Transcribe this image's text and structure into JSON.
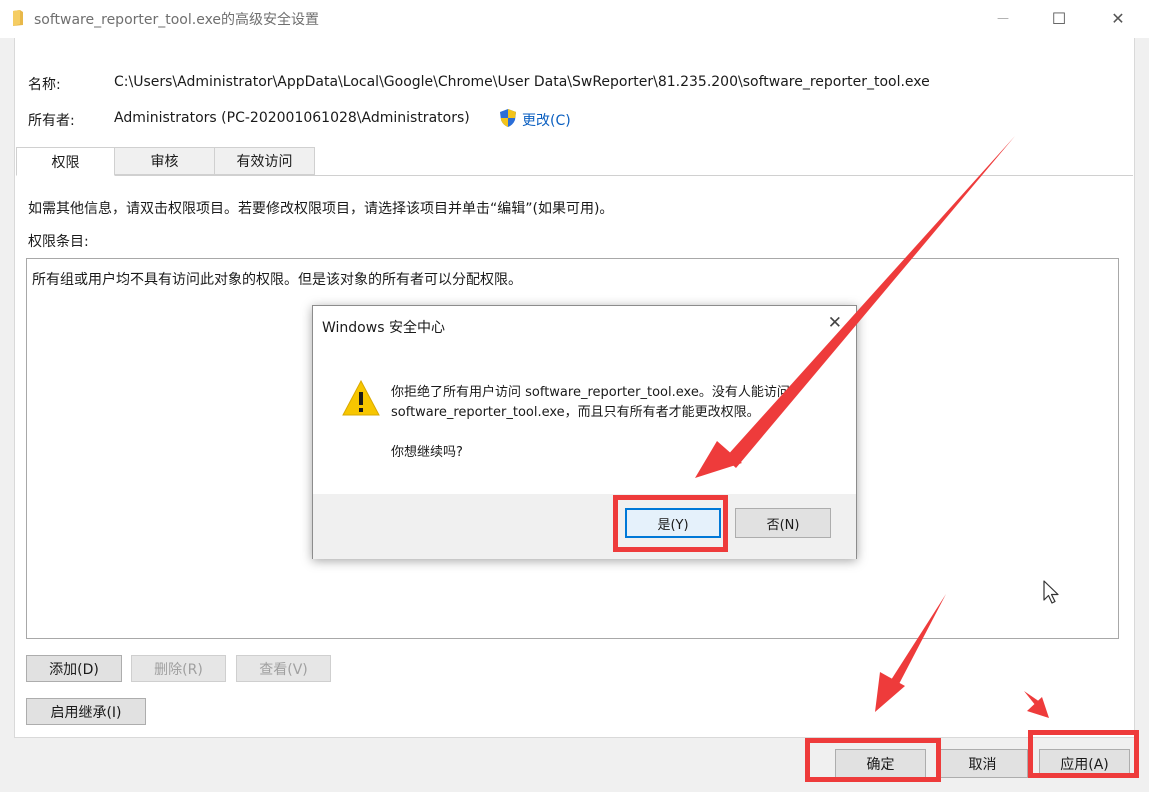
{
  "window": {
    "title": "software_reporter_tool.exe的高级安全设置",
    "controls": {
      "minimize": "—",
      "maximize": "☐",
      "close": "✕"
    }
  },
  "info": {
    "name_label": "名称:",
    "name_value": "C:\\Users\\Administrator\\AppData\\Local\\Google\\Chrome\\User Data\\SwReporter\\81.235.200\\software_reporter_tool.exe",
    "owner_label": "所有者:",
    "owner_value": "Administrators (PC-202001061028\\Administrators)",
    "change_link": "更改(C)"
  },
  "tabs": [
    {
      "label": "权限",
      "active": true
    },
    {
      "label": "审核",
      "active": false
    },
    {
      "label": "有效访问",
      "active": false
    }
  ],
  "permissions": {
    "hint": "如需其他信息，请双击权限项目。若要修改权限项目，请选择该项目并单击“编辑”(如果可用)。",
    "entries_label": "权限条目:",
    "empty_message": "所有组或用户均不具有访问此对象的权限。但是该对象的所有者可以分配权限。",
    "buttons": {
      "add": "添加(D)",
      "remove": "删除(R)",
      "view": "查看(V)",
      "inherit": "启用继承(I)"
    }
  },
  "footer": {
    "ok": "确定",
    "cancel": "取消",
    "apply": "应用(A)"
  },
  "dialog": {
    "title": "Windows 安全中心",
    "close": "✕",
    "message_line1": "你拒绝了所有用户访问 software_reporter_tool.exe。没有人能访问",
    "message_line2": "software_reporter_tool.exe，而且只有所有者才能更改权限。",
    "question": "你想继续吗?",
    "yes": "是(Y)",
    "no": "否(N)"
  },
  "colors": {
    "annotation_red": "#ee3b3b",
    "link_blue": "#0b5fc0",
    "focus_blue": "#0078d7"
  },
  "icons": [
    "folder-icon",
    "shield-icon",
    "warning-icon",
    "mouse-cursor-icon"
  ]
}
